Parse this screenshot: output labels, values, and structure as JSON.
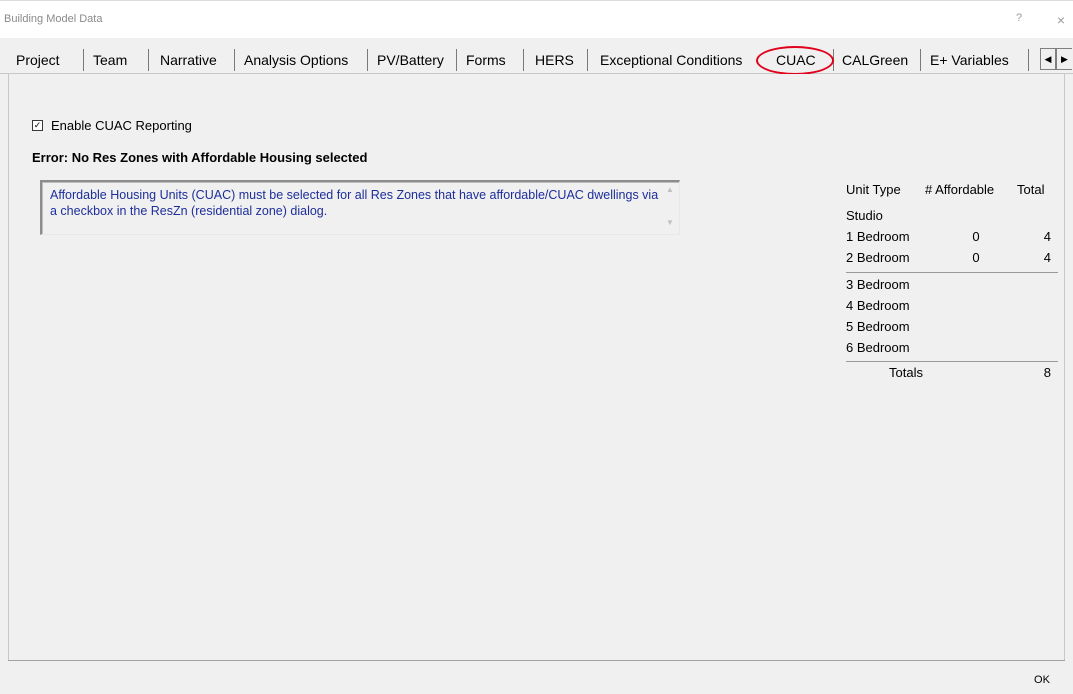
{
  "window": {
    "title": "Building Model Data",
    "help_label": "?",
    "close_label": "×"
  },
  "tabs": [
    {
      "label": "Project"
    },
    {
      "label": "Team"
    },
    {
      "label": "Narrative"
    },
    {
      "label": "Analysis Options"
    },
    {
      "label": "PV/Battery"
    },
    {
      "label": "Forms"
    },
    {
      "label": "HERS"
    },
    {
      "label": "Exceptional Conditions"
    },
    {
      "label": "CUAC"
    },
    {
      "label": "CALGreen"
    },
    {
      "label": "E+ Variables"
    }
  ],
  "active_tab": "CUAC",
  "tab_scroll": {
    "left": "◀",
    "right": "▶"
  },
  "cuac": {
    "enable_label": "Enable CUAC Reporting",
    "enable_checked": true,
    "checkbox_mark": "✓",
    "error_heading": "Error: No Res Zones with Affordable Housing selected",
    "message": "Affordable Housing Units (CUAC) must be selected for all Res Zones that have affordable/CUAC dwellings via a checkbox in the ResZn (residential zone) dialog.",
    "scroll_up": "▲",
    "scroll_down": "▼"
  },
  "units_table": {
    "headers": {
      "type": "Unit Type",
      "affordable": "# Affordable",
      "total": "Total"
    },
    "rows": [
      {
        "type": "Studio",
        "affordable": "",
        "total": ""
      },
      {
        "type": "1 Bedroom",
        "affordable": "0",
        "total": "4"
      },
      {
        "type": "2 Bedroom",
        "affordable": "0",
        "total": "4"
      },
      {
        "type": "3 Bedroom",
        "affordable": "",
        "total": ""
      },
      {
        "type": "4 Bedroom",
        "affordable": "",
        "total": ""
      },
      {
        "type": "5 Bedroom",
        "affordable": "",
        "total": ""
      },
      {
        "type": "6 Bedroom",
        "affordable": "",
        "total": ""
      }
    ],
    "totals_label": "Totals",
    "totals_value": "8"
  },
  "footer": {
    "ok_label": "OK"
  },
  "colors": {
    "message_text": "#1d2e9a",
    "highlight_ring": "#e0001b"
  }
}
